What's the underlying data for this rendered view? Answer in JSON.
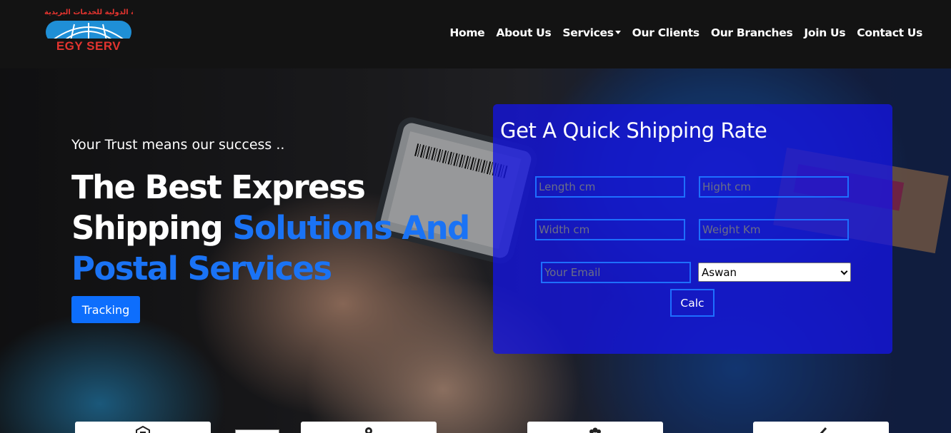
{
  "brand": {
    "arabic_name": "الشركة الدولية للخدمات البريدية",
    "name": "EGY SERV",
    "color": "#e3342f"
  },
  "nav": {
    "items": [
      {
        "label": "Home"
      },
      {
        "label": "About Us"
      },
      {
        "label": "Services",
        "has_dropdown": true
      },
      {
        "label": "Our Clients"
      },
      {
        "label": "Our Branches"
      },
      {
        "label": "Join Us"
      },
      {
        "label": "Contact Us"
      }
    ]
  },
  "hero": {
    "tagline": "Your Trust means our success ..",
    "headline_white_1": "The Best Express Shipping ",
    "headline_accent": "Solutions And Postal Services",
    "tracking_label": "Tracking",
    "accent_color": "#1a73f5"
  },
  "rate_form": {
    "title": "Get A Quick Shipping Rate",
    "length_placeholder": "Length cm",
    "height_placeholder": "Hight cm",
    "width_placeholder": "Width cm",
    "weight_placeholder": "Weight Km",
    "email_placeholder": "Your Email",
    "city_selected": "Aswan",
    "calc_label": "Calc"
  },
  "feature_cards": [
    {
      "icon": "warehouse-icon"
    },
    {
      "icon": "location-pin-icon"
    },
    {
      "icon": "users-icon"
    },
    {
      "icon": "truck-icon"
    }
  ]
}
